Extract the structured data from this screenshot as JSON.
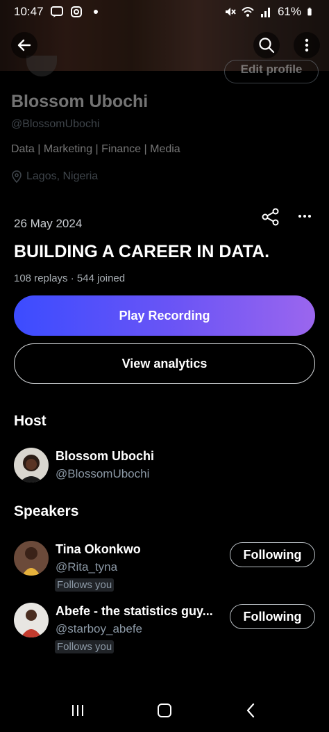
{
  "status_bar": {
    "time": "10:47",
    "battery": "61%",
    "icons": [
      "message-icon",
      "instagram-icon",
      "dot-icon",
      "mute-icon",
      "wifi-icon",
      "signal-icon",
      "battery-icon"
    ]
  },
  "header": {
    "icons": [
      "back-arrow-icon",
      "search-icon",
      "more-vertical-icon"
    ]
  },
  "profile": {
    "edit_button": "Edit profile",
    "name": "Blossom Ubochi",
    "handle": "@BlossomUbochi",
    "bio": "Data | Marketing | Finance | Media",
    "location": "Lagos, Nigeria"
  },
  "space": {
    "date": "26 May 2024",
    "title": "BUILDING A CAREER IN DATA.",
    "stats": "108 replays · 544 joined",
    "play_button": "Play Recording",
    "analytics_button": "View analytics",
    "colors": {
      "play_gradient_start": "#3c4cff",
      "play_gradient_end": "#9b66ee"
    }
  },
  "host": {
    "heading": "Host",
    "name": "Blossom Ubochi",
    "handle": "@BlossomUbochi"
  },
  "speakers": {
    "heading": "Speakers",
    "items": [
      {
        "name": "Tina Okonkwo",
        "handle": "@Rita_tyna",
        "follows_you": "Follows you",
        "button": "Following"
      },
      {
        "name": "Abefe - the statistics guy...",
        "handle": "@starboy_abefe",
        "follows_you": "Follows you",
        "button": "Following"
      }
    ]
  },
  "nav": {
    "icons": [
      "recent-apps-icon",
      "home-icon",
      "back-icon"
    ]
  }
}
